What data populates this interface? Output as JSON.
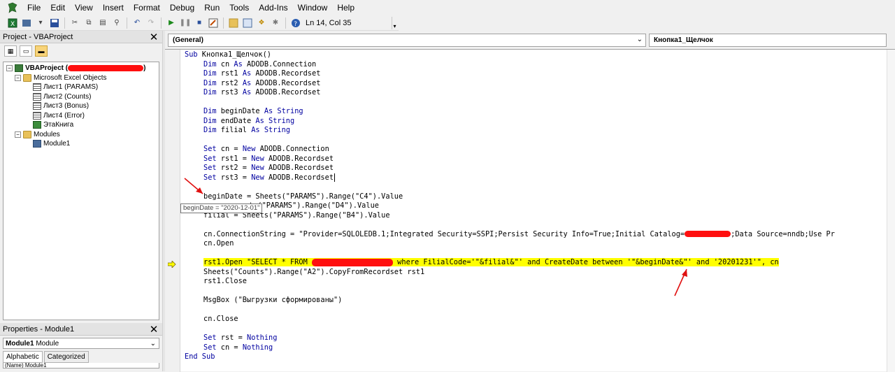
{
  "menubar": {
    "items": [
      "File",
      "Edit",
      "View",
      "Insert",
      "Format",
      "Debug",
      "Run",
      "Tools",
      "Add-Ins",
      "Window",
      "Help"
    ]
  },
  "toolbar": {
    "position": "Ln 14, Col 35"
  },
  "project": {
    "title": "Project - VBAProject",
    "close_glyph": "✕",
    "tree": {
      "root": "VBAProject (",
      "root_close": ")",
      "excel_objects": "Microsoft Excel Objects",
      "sheets": [
        "Лист1 (PARAMS)",
        "Лист2 (Counts)",
        "Лист3 (Bonus)",
        "Лист4 (Error)",
        "ЭтаКнига"
      ],
      "modules_folder": "Modules",
      "modules": [
        "Module1"
      ]
    }
  },
  "properties": {
    "title": "Properties - Module1",
    "close_glyph": "✕",
    "object_name": "Module1",
    "object_type": "Module",
    "tabs": [
      "Alphabetic",
      "Categorized"
    ],
    "first_row": "(Name)  Module1"
  },
  "code_window": {
    "object_combo": "(General)",
    "proc_combo": "Кнопка1_Щелчок",
    "tooltip": "beginDate = \"2020-12-01\"",
    "lines": {
      "l1": "Sub Кнопка1_Щелчок()",
      "l2": "Dim cn As ADODB.Connection",
      "l3": "Dim rst1 As ADODB.Recordset",
      "l4": "Dim rst2 As ADODB.Recordset",
      "l5": "Dim rst3 As ADODB.Recordset",
      "l7": "Dim beginDate As String",
      "l8": "Dim endDate As String",
      "l9": "Dim filial As String",
      "l11": "Set cn = New ADODB.Connection",
      "l12": "Set rst1 = New ADODB.Recordset",
      "l13": "Set rst2 = New ADODB.Recordset",
      "l14": "Set rst3 = New ADODB.Recordset",
      "l16": "beginDate = Sheets(\"PARAMS\").Range(\"C4\").Value",
      "l17": "ts(\"PARAMS\").Range(\"D4\").Value",
      "l18": "filial = Sheets(\"PARAMS\").Range(\"B4\").Value",
      "l20a": "cn.ConnectionString = \"Provider=SQLOLEDB.1;Integrated Security=SSPI;Persist Security Info=True;Initial Catalog=",
      "l20b": ";Data Source=nndb;Use Pr",
      "l21": "cn.Open",
      "l23a": "rst1.Open \"SELECT * FROM ",
      "l23b": " where FilialCode='\"&filial&\"' and CreateDate between '\"&beginDate&\"' and '20201231'\", cn",
      "l24": "Sheets(\"Counts\").Range(\"A2\").CopyFromRecordset rst1",
      "l25": "rst1.Close",
      "l27": "MsgBox (\"Выгрузки сформированы\")",
      "l29": "cn.Close",
      "l31": "Set rst = Nothing",
      "l32": "Set cn = Nothing",
      "l33": "End Sub"
    }
  },
  "colors": {
    "keyword": "#0000a0",
    "highlight": "#ffff00",
    "annotation_arrow": "#e01010",
    "redaction": "#ff0f0f"
  }
}
